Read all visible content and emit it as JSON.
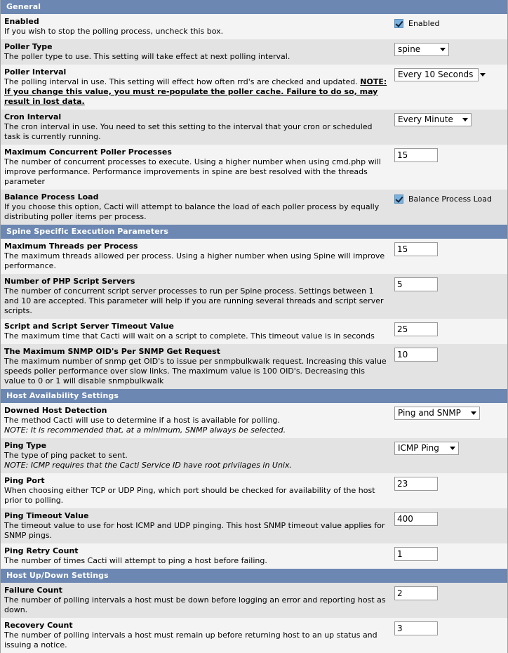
{
  "colors": {
    "section_header_bg": "#6b87b2",
    "section_header_text": "#ffffff",
    "row_odd_bg": "#f4f4f4",
    "row_even_bg": "#e3e3e3",
    "checkbox_fill": "#7ab0dd",
    "input_border": "#9a9a9a"
  },
  "sections": [
    {
      "title": "General",
      "rows": [
        {
          "label": "Enabled",
          "desc": "If you wish to stop the polling process, uncheck this box.",
          "control": {
            "type": "checkbox",
            "checked": true,
            "label": "Enabled"
          }
        },
        {
          "label": "Poller Type",
          "desc": "The poller type to use. This setting will take effect at next polling interval.",
          "control": {
            "type": "select",
            "value": "spine"
          }
        },
        {
          "label": "Poller Interval",
          "desc": "The polling interval in use. This setting will effect how often rrd's are checked and updated. ",
          "desc_note": "NOTE: If you change this value, you must re-populate the poller cache. Failure to do so, may result in lost data.",
          "control": {
            "type": "select",
            "value": "Every 10 Seconds"
          }
        },
        {
          "label": "Cron Interval",
          "desc": "The cron interval in use. You need to set this setting to the interval that your cron or scheduled task is currently running.",
          "control": {
            "type": "select",
            "value": "Every Minute"
          }
        },
        {
          "label": "Maximum Concurrent Poller Processes",
          "desc": "The number of concurrent processes to execute. Using a higher number when using cmd.php will improve performance. Performance improvements in spine are best resolved with the threads parameter",
          "control": {
            "type": "text",
            "value": "15"
          }
        },
        {
          "label": "Balance Process Load",
          "desc": "If you choose this option, Cacti will attempt to balance the load of each poller process by equally distributing poller items per process.",
          "control": {
            "type": "checkbox",
            "checked": true,
            "label": "Balance Process Load"
          }
        }
      ]
    },
    {
      "title": "Spine Specific Execution Parameters",
      "rows": [
        {
          "label": "Maximum Threads per Process",
          "desc": "The maximum threads allowed per process. Using a higher number when using Spine will improve performance.",
          "control": {
            "type": "text",
            "value": "15"
          }
        },
        {
          "label": "Number of PHP Script Servers",
          "desc": "The number of concurrent script server processes to run per Spine process. Settings between 1 and 10 are accepted. This parameter will help if you are running several threads and script server scripts.",
          "control": {
            "type": "text",
            "value": "5"
          }
        },
        {
          "label": "Script and Script Server Timeout Value",
          "desc": "The maximum time that Cacti will wait on a script to complete. This timeout value is in seconds",
          "control": {
            "type": "text",
            "value": "25"
          }
        },
        {
          "label": "The Maximum SNMP OID's Per SNMP Get Request",
          "desc": "The maximum number of snmp get OID's to issue per snmpbulkwalk request. Increasing this value speeds poller performance over slow links. The maximum value is 100 OID's. Decreasing this value to 0 or 1 will disable snmpbulkwalk",
          "control": {
            "type": "text",
            "value": "10"
          }
        }
      ]
    },
    {
      "title": "Host Availability Settings",
      "rows": [
        {
          "label": "Downed Host Detection",
          "desc": "The method Cacti will use to determine if a host is available for polling.",
          "italic_note": "NOTE: It is recommended that, at a minimum, SNMP always be selected.",
          "control": {
            "type": "select",
            "value": "Ping and SNMP"
          }
        },
        {
          "label": "Ping Type",
          "desc": "The type of ping packet to sent.",
          "italic_note": "NOTE: ICMP requires that the Cacti Service ID have root privilages in Unix.",
          "control": {
            "type": "select",
            "value": "ICMP Ping"
          }
        },
        {
          "label": "Ping Port",
          "desc": "When choosing either TCP or UDP Ping, which port should be checked for availability of the host prior to polling.",
          "control": {
            "type": "text",
            "value": "23"
          }
        },
        {
          "label": "Ping Timeout Value",
          "desc": "The timeout value to use for host ICMP and UDP pinging. This host SNMP timeout value applies for SNMP pings.",
          "control": {
            "type": "text",
            "value": "400"
          }
        },
        {
          "label": "Ping Retry Count",
          "desc": "The number of times Cacti will attempt to ping a host before failing.",
          "control": {
            "type": "text",
            "value": "1"
          }
        }
      ]
    },
    {
      "title": "Host Up/Down Settings",
      "rows": [
        {
          "label": "Failure Count",
          "desc": "The number of polling intervals a host must be down before logging an error and reporting host as down.",
          "control": {
            "type": "text",
            "value": "2"
          }
        },
        {
          "label": "Recovery Count",
          "desc": "The number of polling intervals a host must remain up before returning host to an up status and issuing a notice.",
          "control": {
            "type": "text",
            "value": "3"
          }
        }
      ]
    }
  ]
}
